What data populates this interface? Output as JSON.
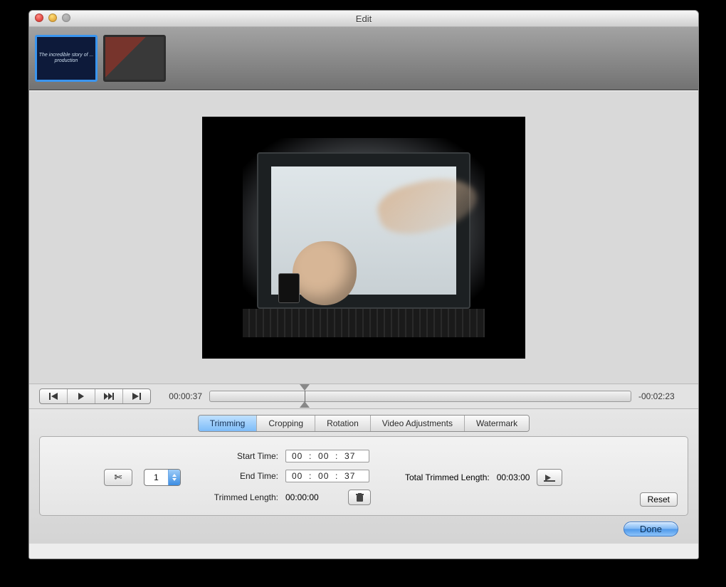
{
  "window": {
    "title": "Edit"
  },
  "thumbs": {
    "item0_text": "The incredible story of ... production"
  },
  "transport": {
    "current_time": "00:00:37",
    "remaining_time": "-00:02:23"
  },
  "tabs": {
    "t0": "Trimming",
    "t1": "Cropping",
    "t2": "Rotation",
    "t3": "Video Adjustments",
    "t4": "Watermark"
  },
  "trimming": {
    "segment_value": "1",
    "start_label": "Start Time:",
    "start_value": "00  :  00  :  37",
    "end_label": "End Time:",
    "end_value": "00  :  00  :  37",
    "trimmed_label": "Trimmed Length:",
    "trimmed_value": "00:00:00",
    "total_label": "Total Trimmed Length:",
    "total_value": "00:03:00",
    "reset_label": "Reset"
  },
  "footer": {
    "done_label": "Done"
  }
}
